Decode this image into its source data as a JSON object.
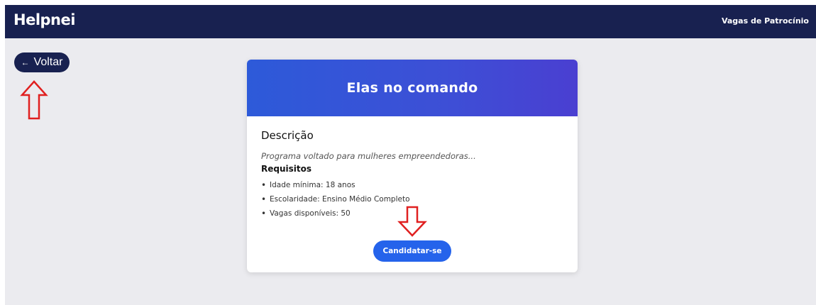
{
  "header": {
    "logo": "Helpnei",
    "nav_link": "Vagas de Patrocínio"
  },
  "back_button": {
    "arrow": "←",
    "label": "Voltar"
  },
  "card": {
    "title": "Elas no comando",
    "description_heading": "Descrição",
    "description": "Programa voltado para mulheres empreendedoras...",
    "requirements_heading": "Requisitos",
    "requirements": [
      "Idade mínima: 18 anos",
      "Escolaridade: Ensino Médio Completo",
      "Vagas disponíveis: 50"
    ],
    "apply_label": "Candidatar-se"
  },
  "colors": {
    "navbar": "#182150",
    "background": "#ebebef",
    "header_gradient_start": "#2d5ad9",
    "header_gradient_end": "#4a3fd1",
    "primary_button": "#2563eb",
    "annotation_arrow": "#e02020"
  },
  "icons": {
    "annotation_up": "up-arrow-annotation-icon",
    "annotation_down": "down-arrow-annotation-icon"
  }
}
